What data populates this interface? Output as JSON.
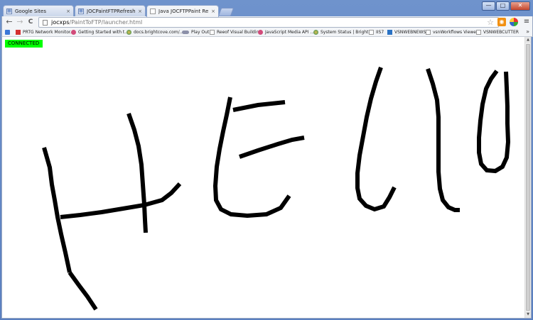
{
  "window": {
    "minimize": "—",
    "maximize": "□",
    "close": "✕"
  },
  "tabs": [
    {
      "label": "Google Sites",
      "favicon": "google-sites-icon",
      "close": "×"
    },
    {
      "label": "JOCPaintFTPRefresh java sc",
      "favicon": "page-icon",
      "close": "×"
    },
    {
      "label": "Java JOCFTPPaint Refresh l",
      "favicon": "document-icon",
      "close": "×",
      "active": true
    }
  ],
  "toolbar": {
    "back": "←",
    "forward": "→",
    "reload": "C",
    "url_host": "jocxps",
    "url_path": "/PaintToFTP/launcher.html",
    "star": "☆",
    "rss": "◉",
    "menu": "≡"
  },
  "bookmarks": [
    {
      "label": "",
      "icon": "apps-icon"
    },
    {
      "label": "PRTG Network Monitor...",
      "icon": "prtg-icon"
    },
    {
      "label": "Getting Started with t...",
      "icon": "circle-icon"
    },
    {
      "label": "docs.brightcove.com/...",
      "icon": "globe-icon"
    },
    {
      "label": "Play Out",
      "icon": "play-icon"
    },
    {
      "label": "Reeof Visual Building",
      "icon": "document-icon"
    },
    {
      "label": "JavaScript Media API ...",
      "icon": "circle-icon"
    },
    {
      "label": "System Status | Bright...",
      "icon": "globe-icon"
    },
    {
      "label": "IIS7",
      "icon": "document-icon"
    },
    {
      "label": "VSNWEBNEWS",
      "icon": "blue-icon"
    },
    {
      "label": "vsnWorkflows Viewer",
      "icon": "document-icon"
    },
    {
      "label": "VSNWEBCUTTER",
      "icon": "document-icon"
    }
  ],
  "bookmarks_more": "»",
  "page": {
    "status": "CONNECTED",
    "status_color": "#00ff00",
    "stroke_color": "#000000",
    "drawing": "handwritten strokes spelling Hello"
  },
  "scrollbar": {
    "up": "▲",
    "down": "▼"
  }
}
